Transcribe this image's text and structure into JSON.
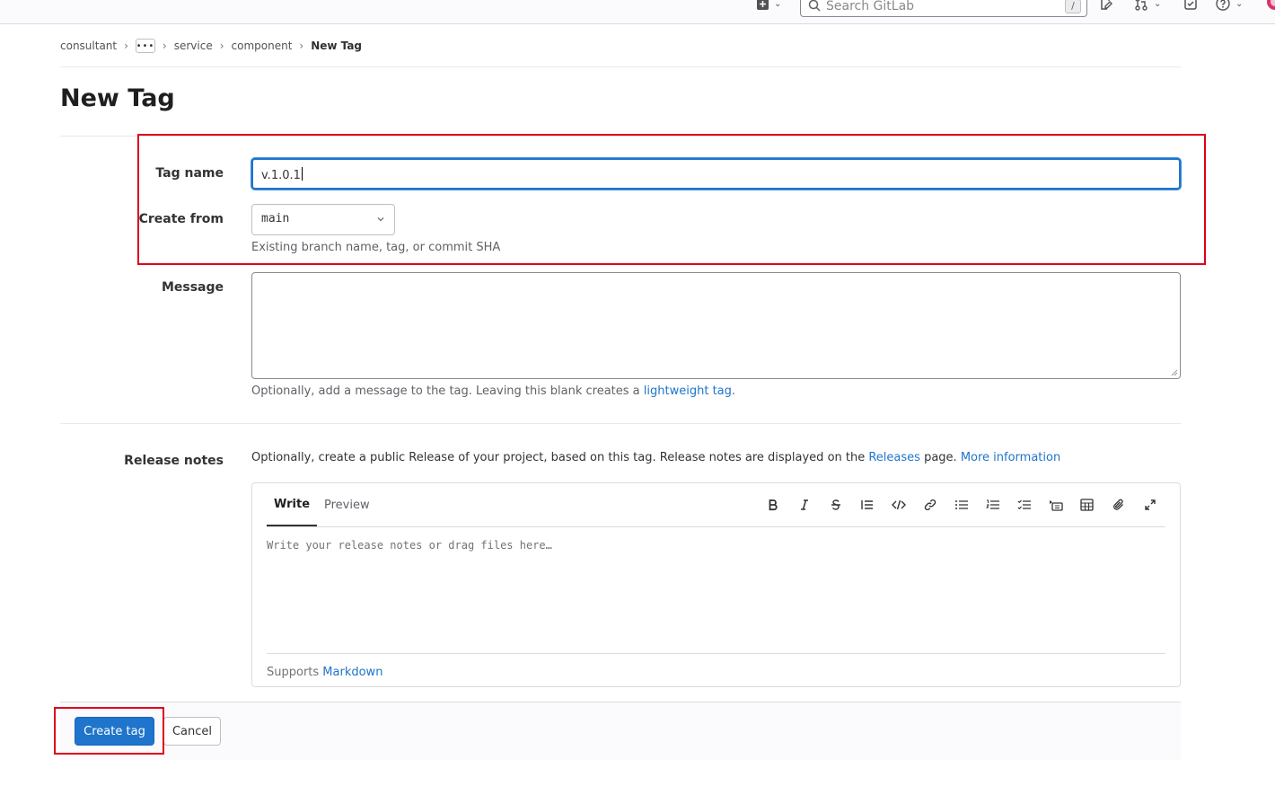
{
  "header": {
    "search_placeholder": "Search GitLab",
    "search_shortcut": "/",
    "icons": [
      "plus-square-icon",
      "chevron-down-icon",
      "search-icon",
      "issues-icon",
      "merge-request-icon",
      "todo-icon",
      "help-icon",
      "avatar"
    ]
  },
  "breadcrumbs": {
    "items": [
      "consultant",
      "service",
      "component"
    ],
    "ellipsis": "•••",
    "current": "New Tag"
  },
  "page": {
    "title": "New Tag"
  },
  "form": {
    "tag_name_label": "Tag name",
    "tag_name_value": "v.1.0.1",
    "create_from_label": "Create from",
    "create_from_value": "main",
    "create_from_help": "Existing branch name, tag, or commit SHA",
    "message_label": "Message",
    "message_help_prefix": "Optionally, add a message to the tag. Leaving this blank creates a ",
    "message_help_link": "lightweight tag",
    "message_help_suffix": ".",
    "release_notes_label": "Release notes",
    "release_intro_prefix": "Optionally, create a public Release of your project, based on this tag. Release notes are displayed on the ",
    "release_intro_link": "Releases",
    "release_intro_mid": " page. ",
    "release_intro_more": "More information"
  },
  "editor": {
    "tab_write": "Write",
    "tab_preview": "Preview",
    "placeholder": "Write your release notes or drag files here…",
    "supports_prefix": "Supports ",
    "supports_link": "Markdown",
    "tools": [
      "bold-icon",
      "italic-icon",
      "strikethrough-icon",
      "quote-icon",
      "code-icon",
      "link-icon",
      "bullet-list-icon",
      "numbered-list-icon",
      "task-list-icon",
      "collapsible-icon",
      "table-icon",
      "attach-icon",
      "fullscreen-icon"
    ]
  },
  "actions": {
    "create_label": "Create tag",
    "cancel_label": "Cancel"
  },
  "colors": {
    "primary": "#1f75cb",
    "highlight": "#e0001b"
  }
}
